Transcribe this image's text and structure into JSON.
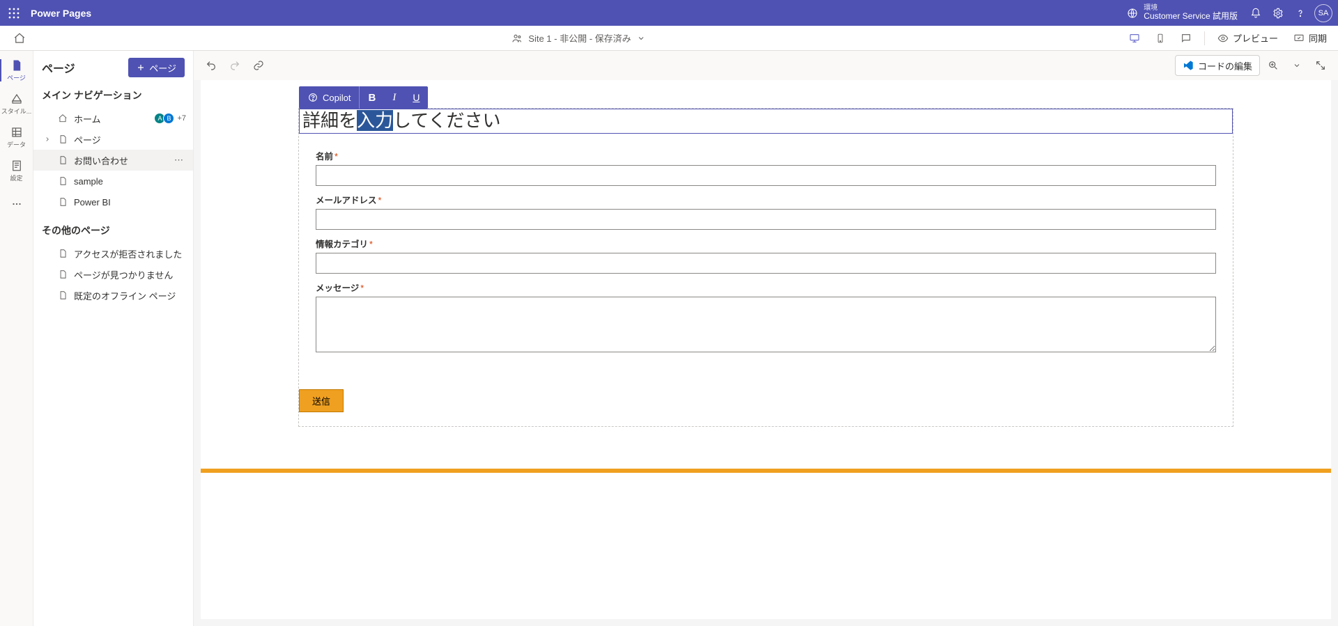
{
  "top": {
    "brand": "Power Pages",
    "env_label": "環境",
    "env_value": "Customer Service 試用版",
    "avatar_initials": "SA"
  },
  "subbar": {
    "site_label": "Site 1 - 非公開 - 保存済み",
    "preview": "プレビュー",
    "sync": "同期"
  },
  "rail": {
    "pages": "ページ",
    "style": "スタイル...",
    "data": "データ",
    "setup": "設定",
    "more": "..."
  },
  "side": {
    "title": "ページ",
    "add_page": "ページ",
    "main_nav_title": "メイン ナビゲーション",
    "home": "ホーム",
    "avatars_plus": "+7",
    "page_group": "ページ",
    "contact": "お問い合わせ",
    "sample": "sample",
    "powerbi": "Power BI",
    "other_title": "その他のページ",
    "access_denied": "アクセスが拒否されました",
    "not_found": "ページが見つかりません",
    "offline": "既定のオフライン ページ"
  },
  "canvas_tb": {
    "edit_code": "コードの編集"
  },
  "float_tb": {
    "copilot": "Copilot",
    "b": "B",
    "i": "I",
    "u": "U"
  },
  "form": {
    "heading_pre": "詳細を",
    "heading_sel": "入力",
    "heading_post": "してください",
    "name_label": "名前",
    "email_label": "メールアドレス",
    "category_label": "情報カテゴリ",
    "message_label": "メッセージ",
    "submit": "送信"
  }
}
